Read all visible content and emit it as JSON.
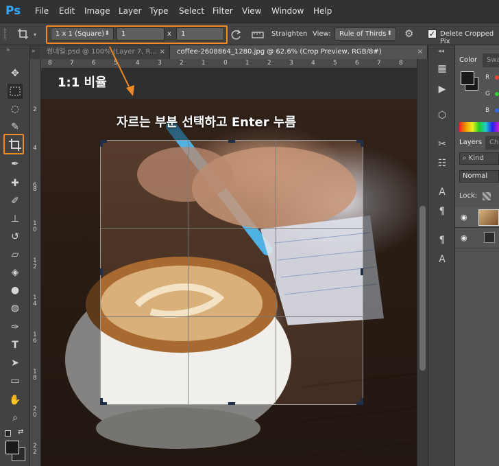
{
  "app": {
    "logo": "Ps"
  },
  "menu": [
    "File",
    "Edit",
    "Image",
    "Layer",
    "Type",
    "Select",
    "Filter",
    "View",
    "Window",
    "Help"
  ],
  "options": {
    "ratio_preset": "1 x 1 (Square)",
    "width_value": "1",
    "separator": "x",
    "height_value": "1",
    "straighten_label": "Straighten",
    "view_label": "View:",
    "view_value": "Rule of Thirds",
    "delete_cropped_label": "Delete Cropped Pix",
    "delete_cropped_checked": true
  },
  "tabs": [
    {
      "label": "썸네일.psd @ 100% (Layer 7, R...",
      "active": false
    },
    {
      "label": "coffee-2608864_1280.jpg @ 62.6% (Crop Preview, RGB/8#)",
      "active": true
    }
  ],
  "ruler_top": [
    "8",
    "7",
    "6",
    "5",
    "4",
    "3",
    "2",
    "1",
    "0",
    "1",
    "2",
    "3",
    "4",
    "5",
    "6",
    "7",
    "8"
  ],
  "ruler_left": [
    "2",
    "4",
    "6",
    "8",
    "1 0",
    "1 2",
    "1 4",
    "1 6",
    "1 8",
    "2 0",
    "2 2"
  ],
  "annotations": {
    "ratio_note": "1:1 비율",
    "instruction": "자르는 부분 선택하고 Enter 누름",
    "highlight_color": "#f08a24"
  },
  "panels": {
    "color_tabs": [
      "Color",
      "Swa"
    ],
    "layers_tabs": [
      "Layers",
      "Cha"
    ],
    "kind_placeholder": "Kind",
    "blend_mode": "Normal",
    "lock_label": "Lock:",
    "channel_letters": [
      "R",
      "G",
      "B"
    ]
  }
}
